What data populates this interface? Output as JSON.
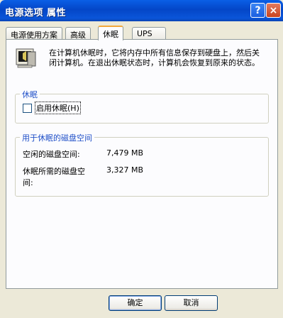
{
  "window": {
    "title": "电源选项 属性",
    "help_glyph": "?",
    "close_glyph": "×"
  },
  "tabs": [
    {
      "label": "电源使用方案",
      "active": false
    },
    {
      "label": "高级",
      "active": false
    },
    {
      "label": "休眠",
      "active": true
    },
    {
      "label": "UPS",
      "active": false
    }
  ],
  "hibernate": {
    "description": "在计算机休眠时，它将内存中所有信息保存到硬盘上，然后关闭计算机。在退出休眠状态时，计算机会恢复到原来的状态。",
    "group_title": "休眠",
    "checkbox_label": "启用休眠(H)",
    "checkbox_checked": false
  },
  "disk_space": {
    "group_title": "用于休眠的磁盘空间",
    "free_label": "空闲的磁盘空间:",
    "free_value": "7,479 MB",
    "required_label": "休眠所需的磁盘空间:",
    "required_value": "3,327 MB"
  },
  "buttons": {
    "ok": "确定",
    "cancel": "取消"
  }
}
